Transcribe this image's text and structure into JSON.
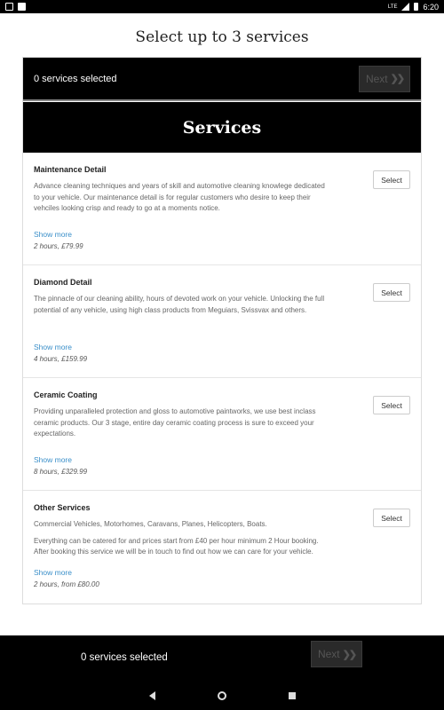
{
  "status_bar": {
    "time": "6:20",
    "lte": "LTE"
  },
  "page": {
    "title": "Select up to 3 services"
  },
  "top_bar": {
    "count_text": "0 services selected",
    "next_label": "Next"
  },
  "header": {
    "title": "Services"
  },
  "services": [
    {
      "name": "Maintenance Detail",
      "description": [
        "Advance cleaning techniques and years of skill and automotive cleaning knowlege dedicated to your vehicle. Our maintenance detail is for regular customers who desire to keep their vehciles looking crisp and ready to go at a moments notice."
      ],
      "show_more": "Show more",
      "meta": "2 hours, £79.99",
      "select_label": "Select"
    },
    {
      "name": "Diamond Detail",
      "description": [
        "The pinnacle of our cleaning ability, hours of devoted work on your vehicle. Unlocking the full potential of any vehicle, using high class products from Meguiars, Svissvax and others."
      ],
      "show_more": "Show more",
      "meta": "4 hours, £159.99",
      "select_label": "Select"
    },
    {
      "name": "Ceramic Coating",
      "description": [
        "Providing unparalleled protection and gloss to automotive paintworks, we use best inclass ceramic products. Our 3 stage, entire day ceramic coating process is sure to exceed your expectations."
      ],
      "show_more": "Show more",
      "meta": "8 hours, £329.99",
      "select_label": "Select"
    },
    {
      "name": "Other Services",
      "description": [
        "Commercial Vehicles, Motorhomes, Caravans, Planes, Helicopters, Boats.",
        "Everything can be catered for and prices start from £40 per hour minimum 2 Hour booking. After booking this service we will be in touch to find out how we can care for your vehicle."
      ],
      "show_more": "Show more",
      "meta": "2 hours, from £80.00",
      "select_label": "Select"
    }
  ],
  "bottom_bar": {
    "count_text": "0 services selected",
    "next_label": "Next"
  }
}
